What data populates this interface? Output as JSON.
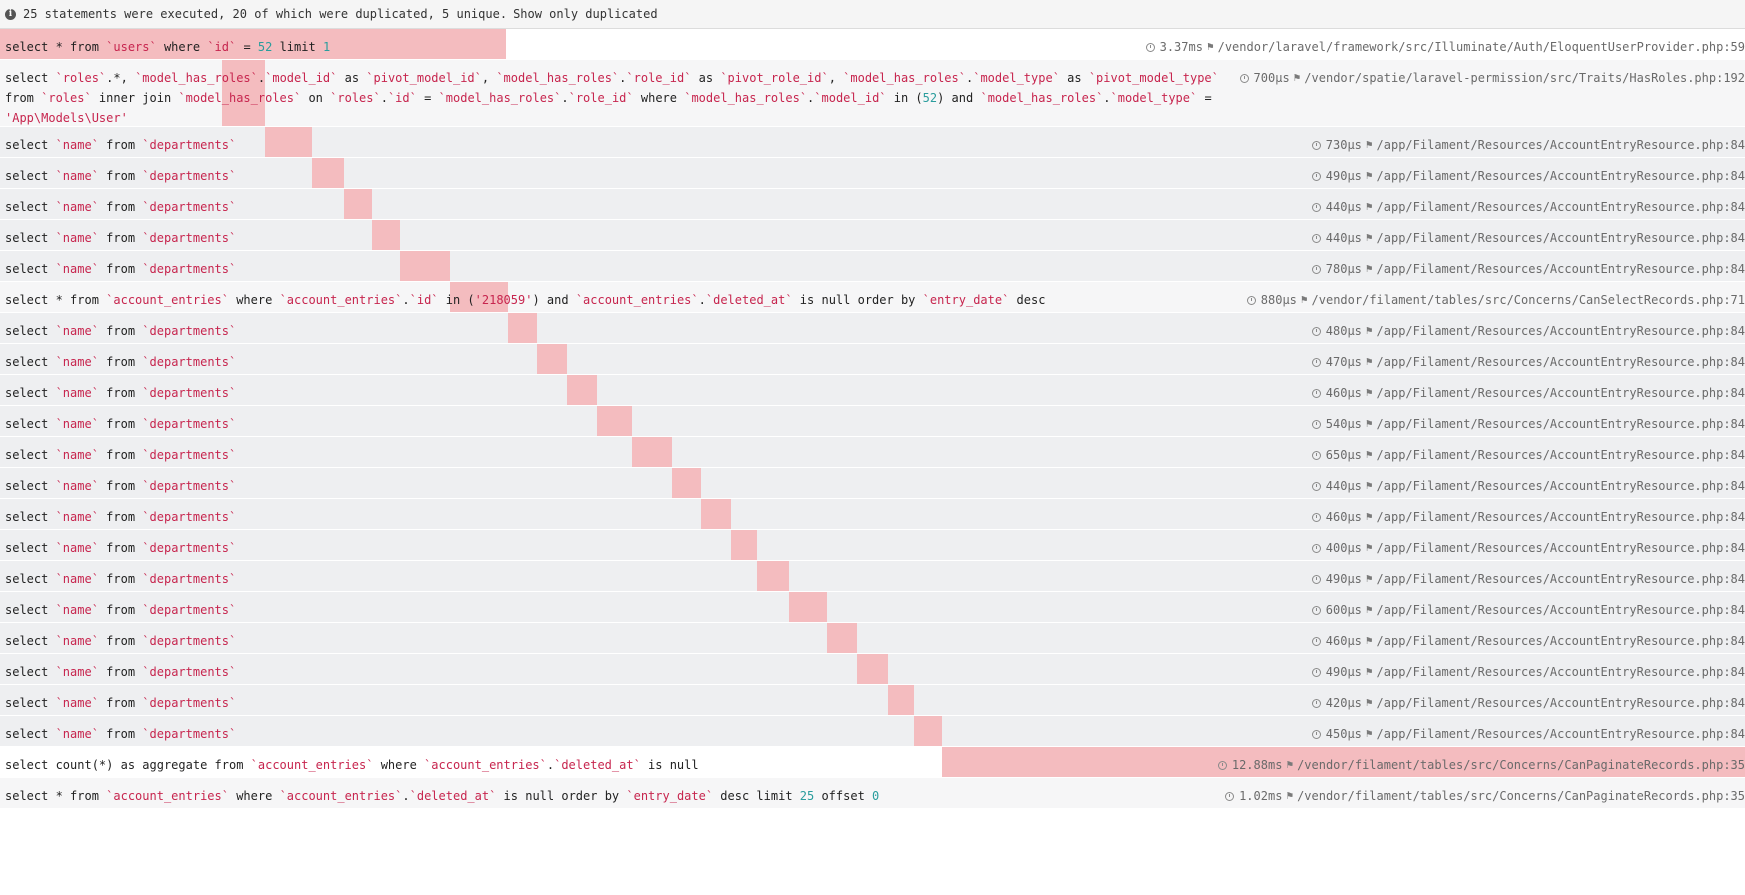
{
  "header": {
    "summary": "25 statements were executed, 20 of which were duplicated, 5 unique.",
    "toggle_label": "Show only duplicated",
    "icon": "info-circle-icon"
  },
  "colors": {
    "duplicate_bar": "#f4bcbf",
    "string_token": "#c7254e",
    "number_token": "#2a9d9d",
    "row_duplicate_bg": "#eeeff1"
  },
  "statements": [
    {
      "sql": [
        [
          "select * from ",
          ""
        ],
        [
          "`users`",
          "s"
        ],
        [
          " where ",
          ""
        ],
        [
          "`id`",
          "s"
        ],
        [
          " = ",
          ""
        ],
        [
          "52",
          "n"
        ],
        [
          " limit ",
          ""
        ],
        [
          "1",
          "n"
        ]
      ],
      "duration": "3.37ms",
      "source": "/vendor/laravel/framework/src/Illuminate/Auth/EloquentUserProvider.php:59",
      "type": "hl",
      "timeline": [
        0,
        0.29
      ],
      "height": 31
    },
    {
      "sql": [
        [
          "select ",
          ""
        ],
        [
          "`roles`",
          "s"
        ],
        [
          ".*, ",
          ""
        ],
        [
          "`model_has_roles`",
          "s"
        ],
        [
          ".",
          ""
        ],
        [
          "`model_id`",
          "s"
        ],
        [
          " as ",
          ""
        ],
        [
          "`pivot_model_id`",
          "s"
        ],
        [
          ", ",
          ""
        ],
        [
          "`model_has_roles`",
          "s"
        ],
        [
          ".",
          ""
        ],
        [
          "`role_id`",
          "s"
        ],
        [
          " as ",
          ""
        ],
        [
          "`pivot_role_id`",
          "s"
        ],
        [
          ", ",
          ""
        ],
        [
          "`model_has_roles`",
          "s"
        ],
        [
          ".",
          ""
        ],
        [
          "`model_type`",
          "s"
        ],
        [
          " as ",
          ""
        ],
        [
          "`pivot_model_type`",
          "s"
        ],
        [
          " from ",
          ""
        ],
        [
          "`roles`",
          "s"
        ],
        [
          " inner join ",
          ""
        ],
        [
          "`model_has_roles`",
          "s"
        ],
        [
          " on ",
          ""
        ],
        [
          "`roles`",
          "s"
        ],
        [
          ".",
          ""
        ],
        [
          "`id`",
          "s"
        ],
        [
          " = ",
          ""
        ],
        [
          "`model_has_roles`",
          "s"
        ],
        [
          ".",
          ""
        ],
        [
          "`role_id`",
          "s"
        ],
        [
          " where ",
          ""
        ],
        [
          "`model_has_roles`",
          "s"
        ],
        [
          ".",
          ""
        ],
        [
          "`model_id`",
          "s"
        ],
        [
          " in (",
          ""
        ],
        [
          "52",
          "n"
        ],
        [
          ") and ",
          ""
        ],
        [
          "`model_has_roles`",
          "s"
        ],
        [
          ".",
          ""
        ],
        [
          "`model_type`",
          "s"
        ],
        [
          " = ",
          ""
        ],
        [
          "'App\\Models\\User'",
          "s"
        ]
      ],
      "duration": "700μs",
      "source": "/vendor/spatie/laravel-permission/src/Traits/HasRoles.php:192",
      "type": "uniq",
      "timeline": [
        0.127,
        0.152
      ],
      "height": 67,
      "multi": true
    },
    {
      "sql": [
        [
          "select ",
          ""
        ],
        [
          "`name`",
          "s"
        ],
        [
          " from ",
          ""
        ],
        [
          "`departments`",
          "s"
        ]
      ],
      "duration": "730μs",
      "source": "/app/Filament/Resources/AccountEntryResource.php:84",
      "type": "dup",
      "timeline": [
        0.152,
        0.179
      ],
      "height": 31
    },
    {
      "sql": [
        [
          "select ",
          ""
        ],
        [
          "`name`",
          "s"
        ],
        [
          " from ",
          ""
        ],
        [
          "`departments`",
          "s"
        ]
      ],
      "duration": "490μs",
      "source": "/app/Filament/Resources/AccountEntryResource.php:84",
      "type": "dup",
      "timeline": [
        0.179,
        0.197
      ],
      "height": 31
    },
    {
      "sql": [
        [
          "select ",
          ""
        ],
        [
          "`name`",
          "s"
        ],
        [
          " from ",
          ""
        ],
        [
          "`departments`",
          "s"
        ]
      ],
      "duration": "440μs",
      "source": "/app/Filament/Resources/AccountEntryResource.php:84",
      "type": "dup",
      "timeline": [
        0.197,
        0.213
      ],
      "height": 31
    },
    {
      "sql": [
        [
          "select ",
          ""
        ],
        [
          "`name`",
          "s"
        ],
        [
          " from ",
          ""
        ],
        [
          "`departments`",
          "s"
        ]
      ],
      "duration": "440μs",
      "source": "/app/Filament/Resources/AccountEntryResource.php:84",
      "type": "dup",
      "timeline": [
        0.213,
        0.229
      ],
      "height": 31
    },
    {
      "sql": [
        [
          "select ",
          ""
        ],
        [
          "`name`",
          "s"
        ],
        [
          " from ",
          ""
        ],
        [
          "`departments`",
          "s"
        ]
      ],
      "duration": "780μs",
      "source": "/app/Filament/Resources/AccountEntryResource.php:84",
      "type": "dup",
      "timeline": [
        0.229,
        0.258
      ],
      "height": 31
    },
    {
      "sql": [
        [
          "select * from ",
          ""
        ],
        [
          "`account_entries`",
          "s"
        ],
        [
          " where ",
          ""
        ],
        [
          "`account_entries`",
          "s"
        ],
        [
          ".",
          ""
        ],
        [
          "`id`",
          "s"
        ],
        [
          " in (",
          ""
        ],
        [
          "'218059'",
          "s"
        ],
        [
          ") and ",
          ""
        ],
        [
          "`account_entries`",
          "s"
        ],
        [
          ".",
          ""
        ],
        [
          "`deleted_at`",
          "s"
        ],
        [
          " is null order by ",
          ""
        ],
        [
          "`entry_date`",
          "s"
        ],
        [
          " desc",
          ""
        ]
      ],
      "duration": "880μs",
      "source": "/vendor/filament/tables/src/Concerns/CanSelectRecords.php:71",
      "type": "uniq",
      "timeline": [
        0.258,
        0.291
      ],
      "height": 31
    },
    {
      "sql": [
        [
          "select ",
          ""
        ],
        [
          "`name`",
          "s"
        ],
        [
          " from ",
          ""
        ],
        [
          "`departments`",
          "s"
        ]
      ],
      "duration": "480μs",
      "source": "/app/Filament/Resources/AccountEntryResource.php:84",
      "type": "dup",
      "timeline": [
        0.291,
        0.308
      ],
      "height": 31
    },
    {
      "sql": [
        [
          "select ",
          ""
        ],
        [
          "`name`",
          "s"
        ],
        [
          " from ",
          ""
        ],
        [
          "`departments`",
          "s"
        ]
      ],
      "duration": "470μs",
      "source": "/app/Filament/Resources/AccountEntryResource.php:84",
      "type": "dup",
      "timeline": [
        0.308,
        0.325
      ],
      "height": 31
    },
    {
      "sql": [
        [
          "select ",
          ""
        ],
        [
          "`name`",
          "s"
        ],
        [
          " from ",
          ""
        ],
        [
          "`departments`",
          "s"
        ]
      ],
      "duration": "460μs",
      "source": "/app/Filament/Resources/AccountEntryResource.php:84",
      "type": "dup",
      "timeline": [
        0.325,
        0.342
      ],
      "height": 31
    },
    {
      "sql": [
        [
          "select ",
          ""
        ],
        [
          "`name`",
          "s"
        ],
        [
          " from ",
          ""
        ],
        [
          "`departments`",
          "s"
        ]
      ],
      "duration": "540μs",
      "source": "/app/Filament/Resources/AccountEntryResource.php:84",
      "type": "dup",
      "timeline": [
        0.342,
        0.362
      ],
      "height": 31
    },
    {
      "sql": [
        [
          "select ",
          ""
        ],
        [
          "`name`",
          "s"
        ],
        [
          " from ",
          ""
        ],
        [
          "`departments`",
          "s"
        ]
      ],
      "duration": "650μs",
      "source": "/app/Filament/Resources/AccountEntryResource.php:84",
      "type": "dup",
      "timeline": [
        0.362,
        0.385
      ],
      "height": 31
    },
    {
      "sql": [
        [
          "select ",
          ""
        ],
        [
          "`name`",
          "s"
        ],
        [
          " from ",
          ""
        ],
        [
          "`departments`",
          "s"
        ]
      ],
      "duration": "440μs",
      "source": "/app/Filament/Resources/AccountEntryResource.php:84",
      "type": "dup",
      "timeline": [
        0.385,
        0.402
      ],
      "height": 31
    },
    {
      "sql": [
        [
          "select ",
          ""
        ],
        [
          "`name`",
          "s"
        ],
        [
          " from ",
          ""
        ],
        [
          "`departments`",
          "s"
        ]
      ],
      "duration": "460μs",
      "source": "/app/Filament/Resources/AccountEntryResource.php:84",
      "type": "dup",
      "timeline": [
        0.402,
        0.419
      ],
      "height": 31
    },
    {
      "sql": [
        [
          "select ",
          ""
        ],
        [
          "`name`",
          "s"
        ],
        [
          " from ",
          ""
        ],
        [
          "`departments`",
          "s"
        ]
      ],
      "duration": "400μs",
      "source": "/app/Filament/Resources/AccountEntryResource.php:84",
      "type": "dup",
      "timeline": [
        0.419,
        0.434
      ],
      "height": 31
    },
    {
      "sql": [
        [
          "select ",
          ""
        ],
        [
          "`name`",
          "s"
        ],
        [
          " from ",
          ""
        ],
        [
          "`departments`",
          "s"
        ]
      ],
      "duration": "490μs",
      "source": "/app/Filament/Resources/AccountEntryResource.php:84",
      "type": "dup",
      "timeline": [
        0.434,
        0.452
      ],
      "height": 31
    },
    {
      "sql": [
        [
          "select ",
          ""
        ],
        [
          "`name`",
          "s"
        ],
        [
          " from ",
          ""
        ],
        [
          "`departments`",
          "s"
        ]
      ],
      "duration": "600μs",
      "source": "/app/Filament/Resources/AccountEntryResource.php:84",
      "type": "dup",
      "timeline": [
        0.452,
        0.474
      ],
      "height": 31
    },
    {
      "sql": [
        [
          "select ",
          ""
        ],
        [
          "`name`",
          "s"
        ],
        [
          " from ",
          ""
        ],
        [
          "`departments`",
          "s"
        ]
      ],
      "duration": "460μs",
      "source": "/app/Filament/Resources/AccountEntryResource.php:84",
      "type": "dup",
      "timeline": [
        0.474,
        0.491
      ],
      "height": 31
    },
    {
      "sql": [
        [
          "select ",
          ""
        ],
        [
          "`name`",
          "s"
        ],
        [
          " from ",
          ""
        ],
        [
          "`departments`",
          "s"
        ]
      ],
      "duration": "490μs",
      "source": "/app/Filament/Resources/AccountEntryResource.php:84",
      "type": "dup",
      "timeline": [
        0.491,
        0.509
      ],
      "height": 31
    },
    {
      "sql": [
        [
          "select ",
          ""
        ],
        [
          "`name`",
          "s"
        ],
        [
          " from ",
          ""
        ],
        [
          "`departments`",
          "s"
        ]
      ],
      "duration": "420μs",
      "source": "/app/Filament/Resources/AccountEntryResource.php:84",
      "type": "dup",
      "timeline": [
        0.509,
        0.524
      ],
      "height": 31
    },
    {
      "sql": [
        [
          "select ",
          ""
        ],
        [
          "`name`",
          "s"
        ],
        [
          " from ",
          ""
        ],
        [
          "`departments`",
          "s"
        ]
      ],
      "duration": "450μs",
      "source": "/app/Filament/Resources/AccountEntryResource.php:84",
      "type": "dup",
      "timeline": [
        0.524,
        0.54
      ],
      "height": 31
    },
    {
      "sql": [
        [
          "select count(*) as aggregate from ",
          ""
        ],
        [
          "`account_entries`",
          "s"
        ],
        [
          " where ",
          ""
        ],
        [
          "`account_entries`",
          "s"
        ],
        [
          ".",
          ""
        ],
        [
          "`deleted_at`",
          "s"
        ],
        [
          " is null",
          ""
        ]
      ],
      "duration": "12.88ms",
      "source": "/vendor/filament/tables/src/Concerns/CanPaginateRecords.php:35",
      "type": "hl",
      "timeline": [
        0.54,
        1.0
      ],
      "height": 31
    },
    {
      "sql": [
        [
          "select * from ",
          ""
        ],
        [
          "`account_entries`",
          "s"
        ],
        [
          " where ",
          ""
        ],
        [
          "`account_entries`",
          "s"
        ],
        [
          ".",
          ""
        ],
        [
          "`deleted_at`",
          "s"
        ],
        [
          " is null order by ",
          ""
        ],
        [
          "`entry_date`",
          "s"
        ],
        [
          " desc limit ",
          ""
        ],
        [
          "25",
          "n"
        ],
        [
          " offset ",
          ""
        ],
        [
          "0",
          "n"
        ]
      ],
      "duration": "1.02ms",
      "source": "/vendor/filament/tables/src/Concerns/CanPaginateRecords.php:35",
      "type": "uniq",
      "timeline": [
        1.0,
        1.0
      ],
      "height": 31
    }
  ]
}
